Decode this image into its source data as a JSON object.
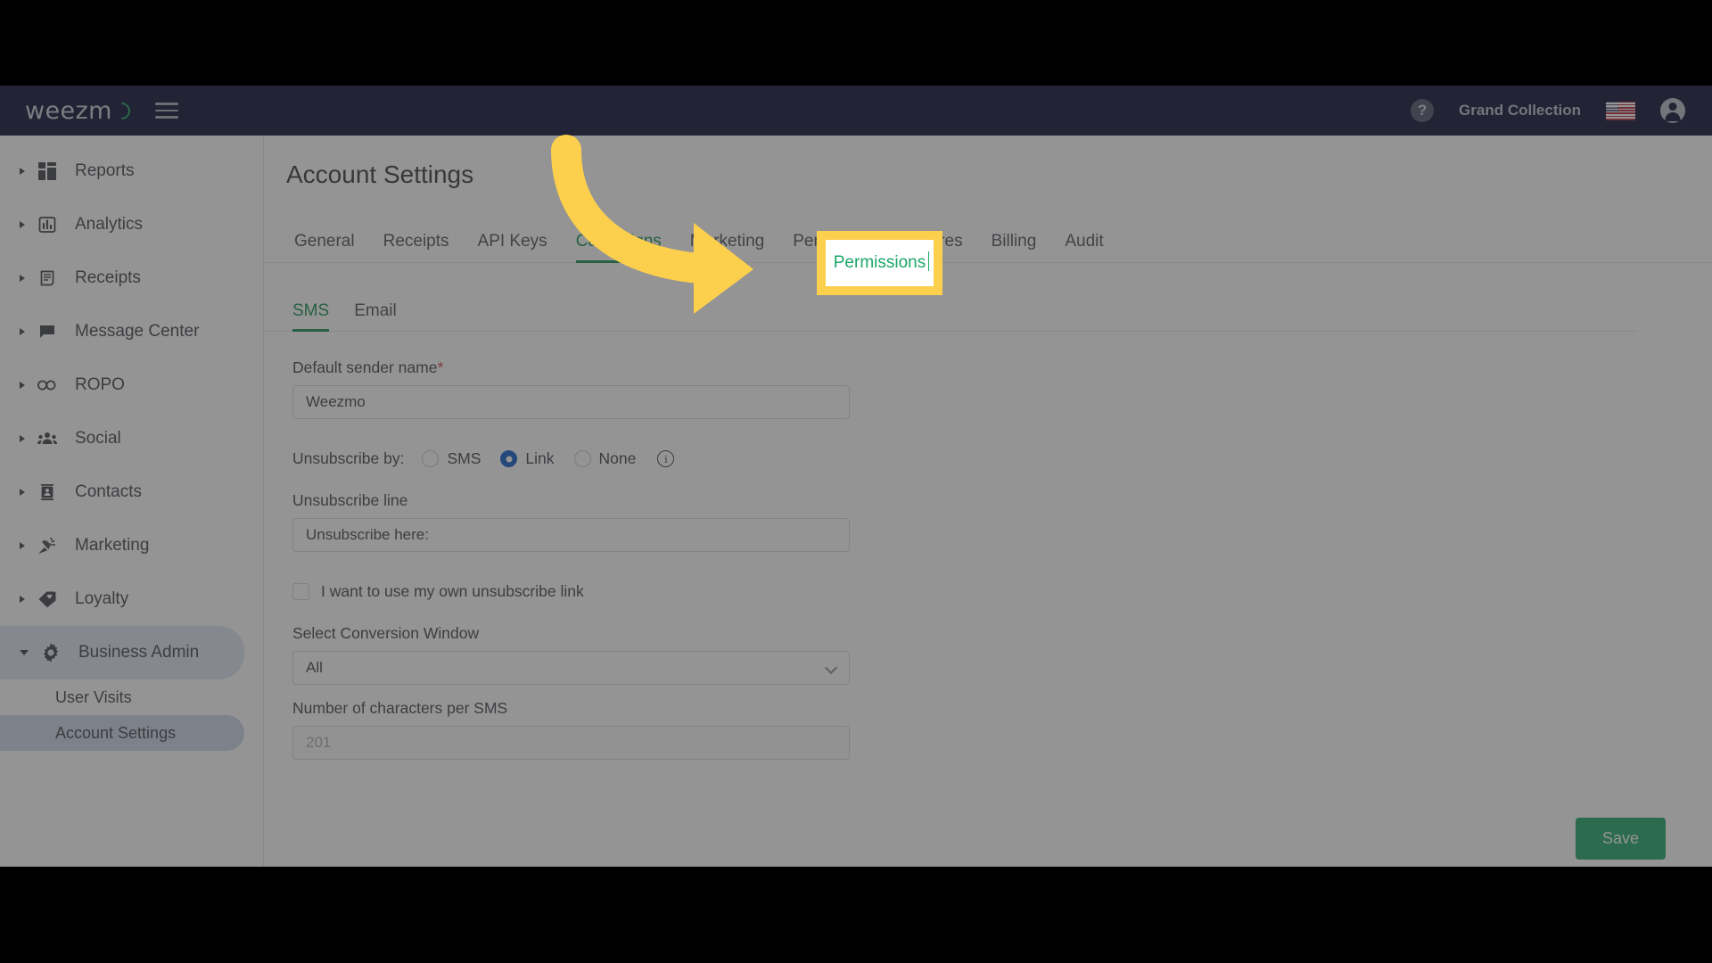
{
  "header": {
    "logo_text": "weezm",
    "logo_icon": "weezmo-o-mark",
    "menu_icon": "hamburger-menu-icon",
    "help_icon": "help-question-icon",
    "help_glyph": "?",
    "org_name": "Grand Collection",
    "flag_icon": "us-flag-icon",
    "avatar_icon": "user-avatar-icon"
  },
  "sidebar": {
    "items": [
      {
        "label": "Reports",
        "icon": "dashboard-grid-icon",
        "expanded": false
      },
      {
        "label": "Analytics",
        "icon": "bar-chart-icon",
        "expanded": false
      },
      {
        "label": "Receipts",
        "icon": "receipt-icon",
        "expanded": false
      },
      {
        "label": "Message Center",
        "icon": "message-bubble-icon",
        "expanded": false
      },
      {
        "label": "ROPO",
        "icon": "infinity-icon",
        "expanded": false
      },
      {
        "label": "Social",
        "icon": "people-group-icon",
        "expanded": false
      },
      {
        "label": "Contacts",
        "icon": "contact-card-icon",
        "expanded": false
      },
      {
        "label": "Marketing",
        "icon": "party-popper-icon",
        "expanded": false
      },
      {
        "label": "Loyalty",
        "icon": "price-tag-heart-icon",
        "expanded": false
      },
      {
        "label": "Business Admin",
        "icon": "gear-icon",
        "expanded": true
      }
    ],
    "subitems": [
      {
        "label": "User Visits",
        "selected": false
      },
      {
        "label": "Account Settings",
        "selected": true
      }
    ]
  },
  "main": {
    "page_title": "Account Settings",
    "tabs": [
      {
        "label": "General",
        "active": false
      },
      {
        "label": "Receipts",
        "active": false
      },
      {
        "label": "API Keys",
        "active": false
      },
      {
        "label": "Campaigns",
        "active": true
      },
      {
        "label": "Marketing",
        "active": false
      },
      {
        "label": "Permissions",
        "active": false
      },
      {
        "label": "Stores",
        "active": false
      },
      {
        "label": "Billing",
        "active": false
      },
      {
        "label": "Audit",
        "active": false
      }
    ],
    "subtabs": [
      {
        "label": "SMS",
        "active": true
      },
      {
        "label": "Email",
        "active": false
      }
    ],
    "form": {
      "sender_name_label": "Default sender name",
      "sender_name_required_mark": "*",
      "sender_name_value": "Weezmo",
      "unsubscribe_by_label": "Unsubscribe by:",
      "unsubscribe_options": [
        {
          "label": "SMS",
          "checked": false
        },
        {
          "label": "Link",
          "checked": true
        },
        {
          "label": "None",
          "checked": false
        }
      ],
      "info_glyph": "i",
      "unsubscribe_line_label": "Unsubscribe line",
      "unsubscribe_line_value": "Unsubscribe here:",
      "own_link_checkbox_label": "I want to use my own unsubscribe link",
      "own_link_checked": false,
      "conversion_window_label": "Select Conversion Window",
      "conversion_window_value": "All",
      "chars_per_sms_label": "Number of characters per SMS",
      "chars_per_sms_placeholder": "201"
    },
    "save_label": "Save"
  },
  "callout": {
    "highlight_tab_label": "Permissions",
    "highlight_border_color": "#fccf4d",
    "arrow_color": "#fccf4d",
    "arrow_icon": "curved-arrow-pointing-right"
  },
  "colors": {
    "navbar_bg": "#04052e",
    "accent_green": "#0f8d4f",
    "radio_blue": "#0b57c8",
    "save_green": "#19a463"
  }
}
